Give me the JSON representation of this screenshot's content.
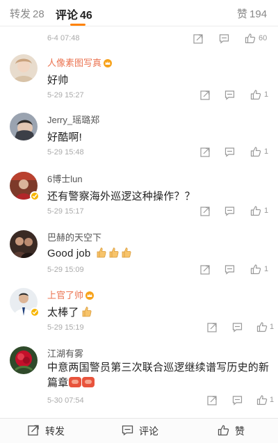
{
  "tabs": {
    "repost": {
      "label": "转发",
      "count": "28"
    },
    "comment": {
      "label": "评论",
      "count": "46"
    },
    "like": {
      "label": "赞",
      "count": "194"
    }
  },
  "first_item": {
    "meta": "6-4 07:48",
    "likes": "60"
  },
  "comments": [
    {
      "user": "人像素图写真",
      "text": "好帅",
      "meta": "5-29 15:27",
      "likes": "1"
    },
    {
      "user": "Jerry_瑶璐郑",
      "text": "好酷啊!",
      "meta": "5-29 15:48",
      "likes": "1"
    },
    {
      "user": "6博士lun",
      "text": "还有警察海外巡逻这种操作？？",
      "meta": "5-29 15:17",
      "likes": "1"
    },
    {
      "user": "巴赫的天空下",
      "text": "Good job",
      "meta": "5-29 15:09",
      "likes": "1"
    },
    {
      "user": "上官了帅",
      "text": "太棒了",
      "meta": "5-29 15:19",
      "likes": "1"
    },
    {
      "user": "江湖有雾",
      "text": "中意两国警员第三次联合巡逻继续谱写历史的新篇章",
      "meta": "5-30 07:54",
      "likes": "1"
    }
  ],
  "bottom_bar": {
    "repost": "转发",
    "comment": "评论",
    "like": "赞"
  },
  "colors": {
    "accent": "#ff8200",
    "vip_name": "#eb7350",
    "verified": "#f7b500"
  },
  "icons": [
    "repost-icon",
    "comment-icon",
    "like-icon",
    "crown-icon",
    "verified-icon",
    "thumbs-up-emoji",
    "clap-sticker"
  ]
}
